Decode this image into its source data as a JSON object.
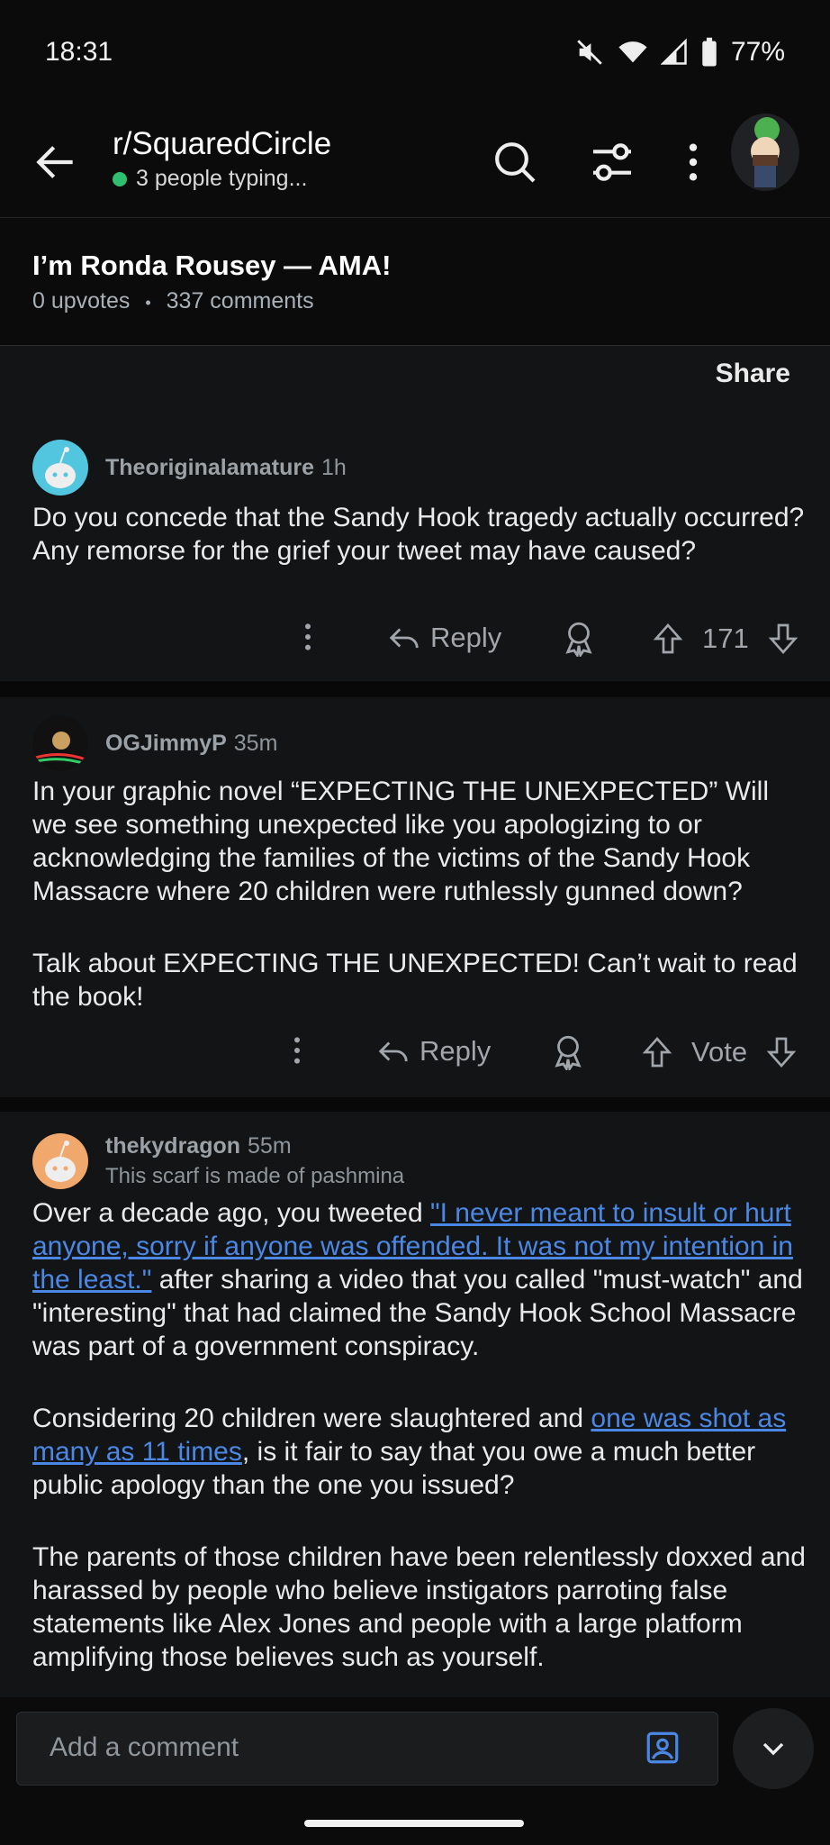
{
  "status": {
    "time": "18:31",
    "battery": "77%"
  },
  "header": {
    "subreddit": "r/SquaredCircle",
    "typing": "3 people typing..."
  },
  "post": {
    "title": "I’m Ronda Rousey — AMA!",
    "upvotes": "0 upvotes",
    "dot": "•",
    "comments": "337 comments",
    "share": "Share"
  },
  "comments": [
    {
      "user": "Theoriginalamature",
      "time": "1h",
      "body": "Do you concede that the Sandy Hook tragedy actually occurred? Any remorse for the grief your tweet may have caused?",
      "reply": "Reply",
      "score": "171"
    },
    {
      "user": "OGJimmyP",
      "time": "35m",
      "body1": "In your graphic novel “EXPECTING THE UNEXPECTED” Will we see something unexpected like you apologizing to or acknowledging the families of the victims of the Sandy Hook Massacre where 20 children were ruthlessly gunned down?",
      "body2": "Talk about EXPECTING THE UNEXPECTED! Can’t wait to read the book!",
      "reply": "Reply",
      "score": "Vote"
    },
    {
      "user": "thekydragon",
      "time": "55m",
      "flair": "This scarf is made of pashmina",
      "p1_a": "Over a decade ago, you tweeted ",
      "p1_link": "\"I never meant to insult or hurt anyone, sorry if anyone was offended. It was not my intention in the least.\"",
      "p1_b": " after sharing a video that you called \"must-watch\" and \"interesting\" that had claimed the Sandy Hook School Massacre was part of a government conspiracy.",
      "p2_a": "Considering 20 children were slaughtered and ",
      "p2_link": "one was shot as many as 11 times",
      "p2_b": ", is it fair to say that you owe a much better public apology than the one you issued?",
      "p3": "The parents of those children have been relentlessly doxxed and harassed by people who believe instigators parroting false statements like Alex Jones and people with a large platform amplifying those believes such as yourself."
    }
  ],
  "composer": {
    "placeholder": "Add a comment"
  }
}
